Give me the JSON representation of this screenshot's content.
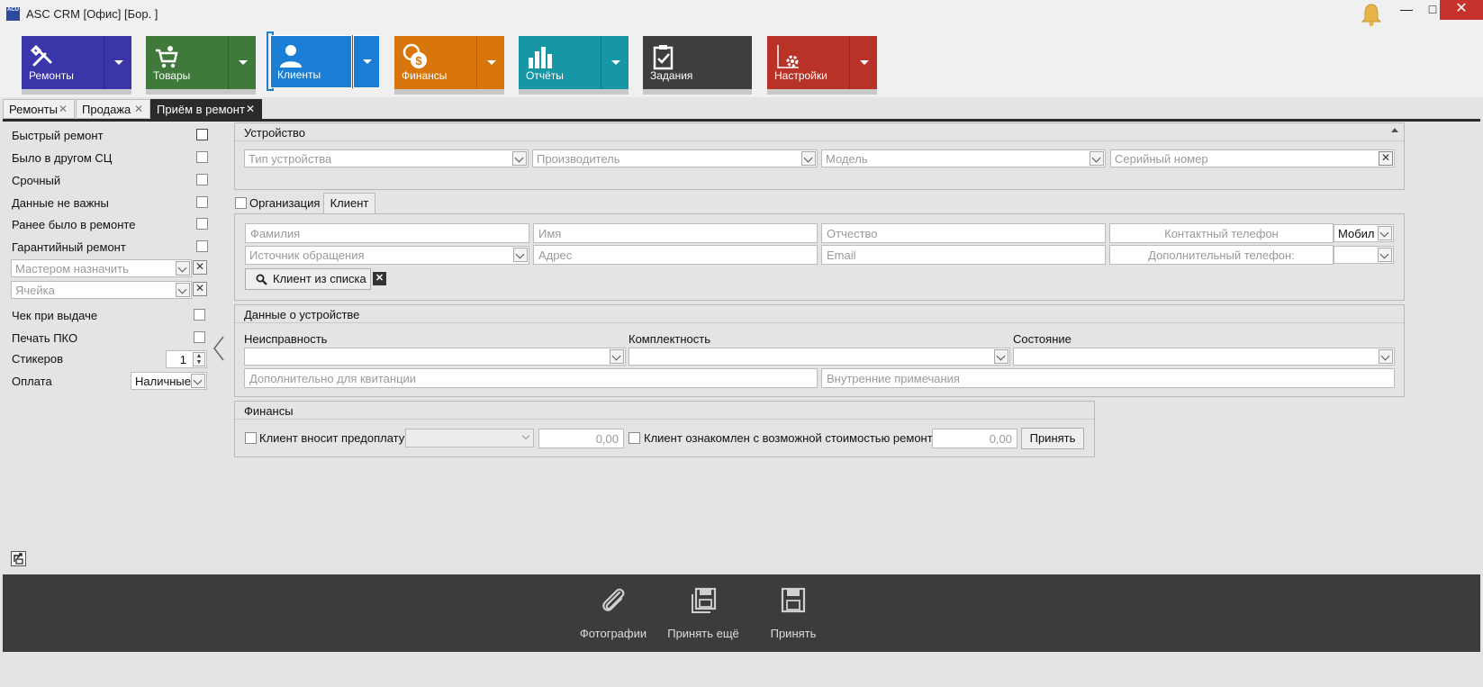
{
  "window": {
    "title": "ASC CRM [Офис] [Бор.                  ]",
    "icon_text": "ACU",
    "minimize": "—",
    "maximize": "□",
    "close": "✕"
  },
  "ribbon": {
    "tiles": [
      {
        "label": "Ремонты",
        "color": "#3a35a8",
        "icon": "tools-icon"
      },
      {
        "label": "Товары",
        "color": "#3f7a3a",
        "icon": "cart-icon"
      },
      {
        "label": "Клиенты",
        "color": "#1a7fd4",
        "icon": "user-icon"
      },
      {
        "label": "Финансы",
        "color": "#d9760b",
        "icon": "coins-icon"
      },
      {
        "label": "Отчёты",
        "color": "#1796a6",
        "icon": "bar-chart-icon"
      },
      {
        "label": "Задания",
        "color": "#3e3e3e",
        "icon": "clipboard-icon"
      },
      {
        "label": "Настройки",
        "color": "#b83228",
        "icon": "settings-icon"
      }
    ]
  },
  "tabs": [
    {
      "label": "Ремонты",
      "active": false
    },
    {
      "label": "Продажа",
      "active": false
    },
    {
      "label": "Приём в ремонт",
      "active": true
    }
  ],
  "left_panel": {
    "options": [
      "Быстрый ремонт",
      "Было в другом СЦ",
      "Срочный",
      "Данные не важны",
      "Ранее было в ремонте",
      "Гарантийный ремонт"
    ],
    "master_placeholder": "Мастером назначить",
    "cell_placeholder": "Ячейка",
    "receipt_label": "Чек при выдаче",
    "pko_label": "Печать ПКО",
    "stickers_label": "Стикеров",
    "stickers_value": "1",
    "payment_label": "Оплата",
    "payment_value": "Наличные"
  },
  "device": {
    "title": "Устройство",
    "type_placeholder": "Тип устройства",
    "maker_placeholder": "Производитель",
    "model_placeholder": "Модель",
    "serial_placeholder": "Серийный номер"
  },
  "client": {
    "org_label": "Организация",
    "tab_label": "Клиент",
    "surname_placeholder": "Фамилия",
    "name_placeholder": "Имя",
    "patronymic_placeholder": "Отчество",
    "phone_placeholder": "Контактный телефон",
    "phone_type": "Мобил",
    "source_placeholder": "Источник обращения",
    "address_placeholder": "Адрес",
    "email_placeholder": "Email",
    "extra_phone_placeholder": "Дополнительный телефон:",
    "from_list_button": "Клиент из списка"
  },
  "device_data": {
    "title": "Данные о устройстве",
    "fault_label": "Неисправность",
    "kit_label": "Комплектность",
    "state_label": "Состояние",
    "extra_placeholder": "Дополнительно для квитанции",
    "notes_placeholder": "Внутренние примечания"
  },
  "finance": {
    "title": "Финансы",
    "prepay_label": "Клиент вносит предоплату:",
    "prepay_amount": "0,00",
    "informed_label": "Клиент ознакомлен с возможной стоимостью ремонта:",
    "cost_amount": "0,00",
    "accept_button": "Принять"
  },
  "footer": {
    "photos": "Фотографии",
    "accept_more": "Принять ещё",
    "accept": "Принять"
  }
}
